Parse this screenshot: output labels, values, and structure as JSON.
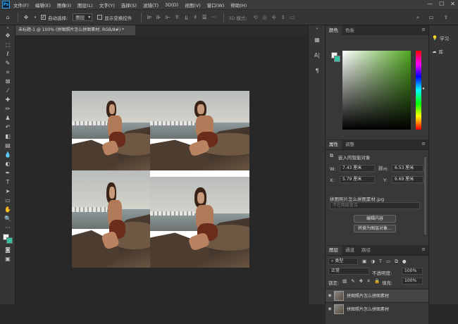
{
  "menubar": {
    "logo": "Ps",
    "items": [
      "文件(F)",
      "编辑(E)",
      "图像(I)",
      "图层(L)",
      "文字(Y)",
      "选择(S)",
      "滤镜(T)",
      "3D(D)",
      "视图(V)",
      "窗口(W)",
      "帮助(H)"
    ],
    "controls": [
      "—",
      "☐",
      "✕"
    ]
  },
  "options": {
    "auto_select_label": "自动选择:",
    "auto_select_value": "图层",
    "show_transform_label": "显示变换控件",
    "mode_3d": "3D 模式:"
  },
  "document": {
    "tab_title": "未标题-1 @ 100% (拼图照片怎么拼图素材, RGB/8#) *",
    "tab_close": "×"
  },
  "panels": {
    "color_tabs": [
      "颜色",
      "色板"
    ],
    "props_tabs": [
      "属性",
      "调整"
    ],
    "smart_object_label": "嵌入的智能对象",
    "w_label": "W:",
    "w_value": "7.43 厘米",
    "h_label": "H:",
    "h_value": "6.53 厘米",
    "x_label": "X:",
    "x_value": "5.79 厘米",
    "y_label": "Y:",
    "y_value": "6.69 厘米",
    "file_name": "拼图照片怎么拼图素材.jpg",
    "not_in_comp": "不在图层复合",
    "edit_contents": "编辑内容",
    "convert_layers": "转换为图层对象...",
    "layers_tabs": [
      "图层",
      "通道",
      "路径"
    ],
    "filter_type": "类型",
    "blend_mode": "正常",
    "opacity_label": "不透明度:",
    "opacity_value": "100%",
    "lock_label": "锁定:",
    "fill_label": "填充:",
    "fill_value": "100%",
    "layers": [
      "拼图照片怎么拼图素材",
      "拼图照片怎么拼图素材"
    ]
  },
  "learn": {
    "items": [
      "学习",
      "库"
    ]
  },
  "colors": {
    "foreground": "#f0f0f0",
    "background": "#34c3a1",
    "hue_color": "#4fa61f"
  }
}
